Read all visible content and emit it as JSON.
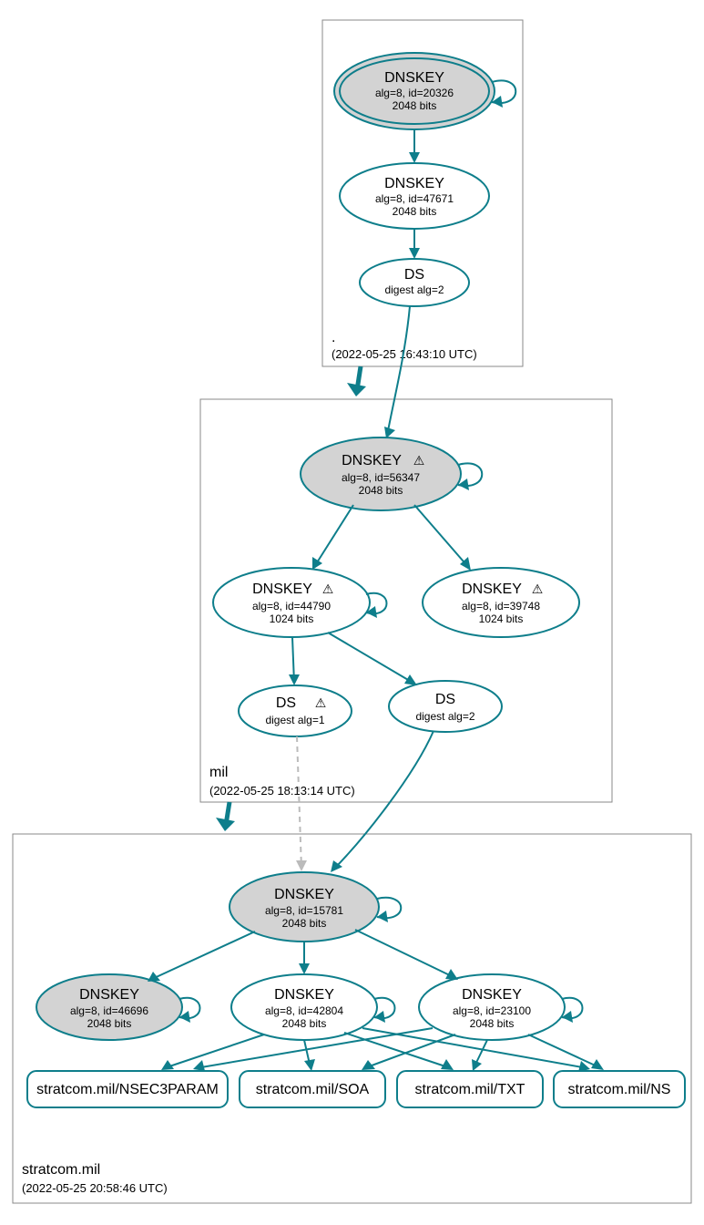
{
  "colors": {
    "accent": "#0e7e8b",
    "fill": "#d3d3d3"
  },
  "zones": {
    "root": {
      "name": ".",
      "timestamp": "(2022-05-25 16:43:10 UTC)"
    },
    "mil": {
      "name": "mil",
      "timestamp": "(2022-05-25 18:13:14 UTC)"
    },
    "stratcom": {
      "name": "stratcom.mil",
      "timestamp": "(2022-05-25 20:58:46 UTC)"
    }
  },
  "nodes": {
    "root_ksk": {
      "title": "DNSKEY",
      "line2": "alg=8, id=20326",
      "line3": "2048 bits"
    },
    "root_zsk": {
      "title": "DNSKEY",
      "line2": "alg=8, id=47671",
      "line3": "2048 bits"
    },
    "root_ds": {
      "title": "DS",
      "line2": "digest alg=2"
    },
    "mil_ksk": {
      "title": "DNSKEY",
      "warn": "⚠",
      "line2": "alg=8, id=56347",
      "line3": "2048 bits"
    },
    "mil_zsk1": {
      "title": "DNSKEY",
      "warn": "⚠",
      "line2": "alg=8, id=44790",
      "line3": "1024 bits"
    },
    "mil_zsk2": {
      "title": "DNSKEY",
      "warn": "⚠",
      "line2": "alg=8, id=39748",
      "line3": "1024 bits"
    },
    "mil_ds1": {
      "title": "DS",
      "warn": "⚠",
      "line2": "digest alg=1"
    },
    "mil_ds2": {
      "title": "DS",
      "line2": "digest alg=2"
    },
    "s_ksk": {
      "title": "DNSKEY",
      "line2": "alg=8, id=15781",
      "line3": "2048 bits"
    },
    "s_k2": {
      "title": "DNSKEY",
      "line2": "alg=8, id=46696",
      "line3": "2048 bits"
    },
    "s_k3": {
      "title": "DNSKEY",
      "line2": "alg=8, id=42804",
      "line3": "2048 bits"
    },
    "s_k4": {
      "title": "DNSKEY",
      "line2": "alg=8, id=23100",
      "line3": "2048 bits"
    },
    "rr_nsec3": {
      "label": "stratcom.mil/NSEC3PARAM"
    },
    "rr_soa": {
      "label": "stratcom.mil/SOA"
    },
    "rr_txt": {
      "label": "stratcom.mil/TXT"
    },
    "rr_ns": {
      "label": "stratcom.mil/NS"
    }
  }
}
